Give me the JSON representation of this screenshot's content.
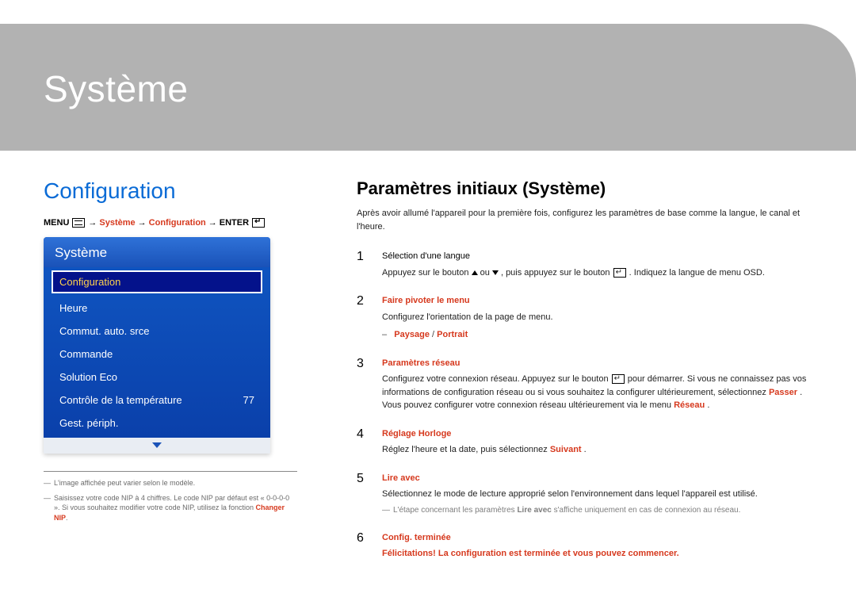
{
  "header": {
    "title": "Système"
  },
  "left": {
    "section_title": "Configuration",
    "breadcrumb": {
      "menu_label": "MENU",
      "arrow": "→",
      "seg_system": "Système",
      "seg_config": "Configuration",
      "enter_label": "ENTER"
    },
    "menu": {
      "title": "Système",
      "items": [
        {
          "label": "Configuration",
          "selected": true
        },
        {
          "label": "Heure"
        },
        {
          "label": "Commut. auto. srce"
        },
        {
          "label": "Commande"
        },
        {
          "label": "Solution Eco"
        },
        {
          "label": "Contrôle de la température",
          "value": "77"
        },
        {
          "label": "Gest. périph."
        }
      ]
    },
    "footnotes": [
      {
        "text": "L'image affichée peut varier selon le modèle."
      },
      {
        "text": "Saisissez votre code NIP à 4 chiffres. Le code NIP par défaut est « 0-0-0-0 ».\nSi vous souhaitez modifier votre code NIP, utilisez la fonction ",
        "hl": "Changer NIP",
        "tail": "."
      }
    ]
  },
  "right": {
    "title": "Paramètres initiaux (Système)",
    "intro": "Après avoir allumé l'appareil pour la première fois, configurez les paramètres de base comme la langue, le canal et l'heure.",
    "steps": [
      {
        "num": "1",
        "title_plain": "Sélection d'une langue",
        "body_pre": "Appuyez sur le bouton ",
        "body_mid": " ou ",
        "body_post1": " , puis appuyez sur le bouton ",
        "body_post2": ". Indiquez la langue de menu OSD."
      },
      {
        "num": "2",
        "title": "Faire pivoter le menu",
        "body": "Configurez l'orientation de la page de menu.",
        "sub_dash": "–",
        "sub_opt1": "Paysage",
        "sub_sep": " / ",
        "sub_opt2": "Portrait"
      },
      {
        "num": "3",
        "title": "Paramètres réseau",
        "body_pre": "Configurez votre connexion réseau. Appuyez sur le bouton ",
        "body_post": " pour démarrer. Si vous ne connaissez pas vos informations de configuration réseau ou si vous souhaitez la configurer ultérieurement, sélectionnez ",
        "hl1": "Passer",
        "body_tail": ". Vous pouvez configurer votre connexion réseau ultérieurement via le menu ",
        "hl2": "Réseau",
        "period": "."
      },
      {
        "num": "4",
        "title": "Réglage Horloge",
        "body_pre": "Réglez l'heure et la date, puis sélectionnez ",
        "hl": "Suivant",
        "period": "."
      },
      {
        "num": "5",
        "title": "Lire avec",
        "body": "Sélectionnez le mode de lecture approprié selon l'environnement dans lequel l'appareil est utilisé.",
        "sub_dash": "―",
        "sub_pre": "L'étape concernant les paramètres ",
        "sub_hl": "Lire avec",
        "sub_post": " s'affiche uniquement en cas de connexion au réseau."
      },
      {
        "num": "6",
        "title": "Config. terminée",
        "body_hl": "Félicitations! La configuration est terminée et vous pouvez commencer."
      }
    ]
  }
}
